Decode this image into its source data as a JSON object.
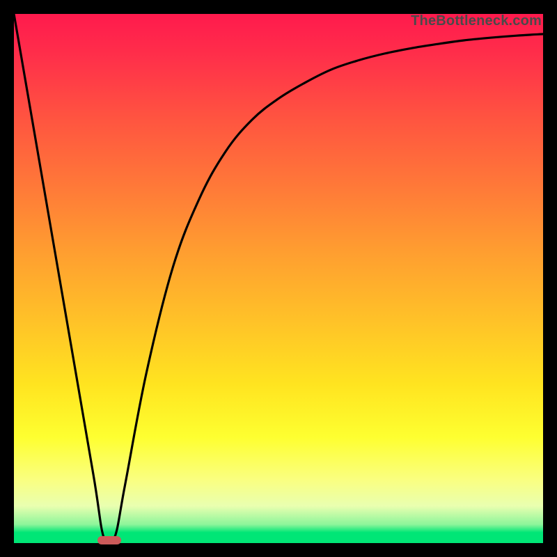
{
  "watermark": "TheBottleneck.com",
  "colors": {
    "frame": "#000000",
    "curve": "#000000",
    "marker": "#cc5a5a",
    "gradient_top": "#ff1a4d",
    "gradient_bottom": "#00e676"
  },
  "chart_data": {
    "type": "line",
    "title": "",
    "xlabel": "",
    "ylabel": "",
    "xlim": [
      0,
      100
    ],
    "ylim": [
      0,
      100
    ],
    "series": [
      {
        "name": "bottleneck-curve",
        "x": [
          0,
          5,
          10,
          15,
          17,
          19,
          21,
          25,
          30,
          35,
          40,
          45,
          50,
          55,
          60,
          65,
          70,
          75,
          80,
          85,
          90,
          95,
          100
        ],
        "values": [
          100,
          71,
          42,
          13,
          1,
          1,
          11,
          32,
          52,
          65,
          74,
          80,
          84,
          87,
          89.5,
          91.2,
          92.5,
          93.5,
          94.3,
          95,
          95.5,
          95.9,
          96.2
        ]
      }
    ],
    "marker": {
      "x": 18,
      "y": 0.5
    },
    "legend": false,
    "grid": false
  }
}
